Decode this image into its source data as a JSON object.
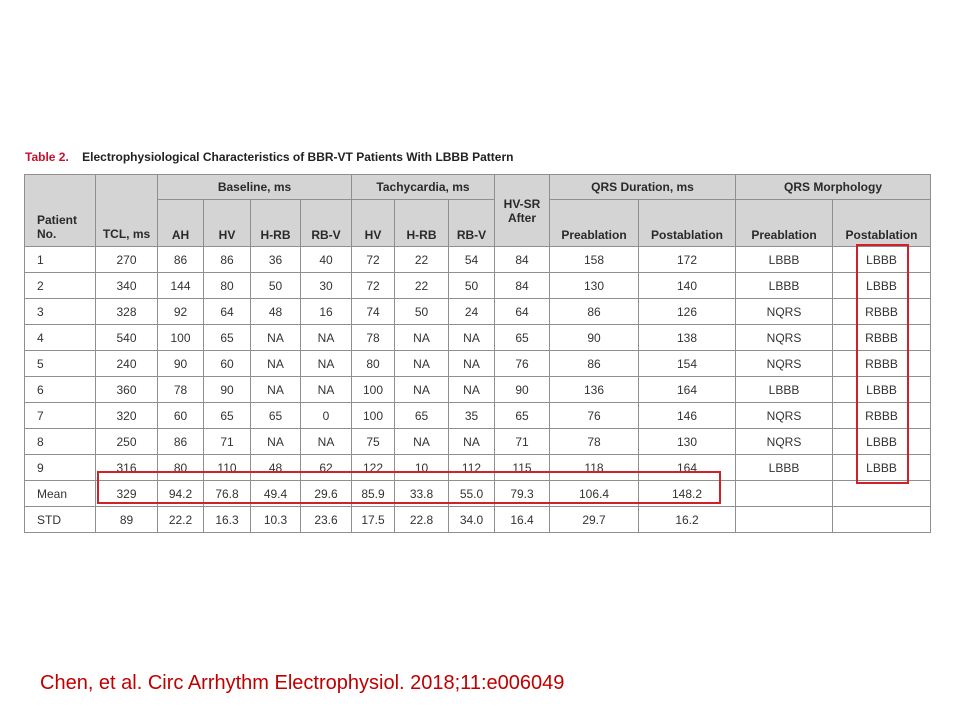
{
  "table": {
    "number": "Table 2.",
    "title": "Electrophysiological Characteristics of BBR-VT Patients With LBBB Pattern",
    "group_headers": {
      "patient": "Patient No.",
      "tcl": "TCL, ms",
      "baseline": "Baseline, ms",
      "tachycardia": "Tachycardia, ms",
      "hvsr": "HV-SR After",
      "qrs_duration": "QRS Duration, ms",
      "qrs_morphology": "QRS Morphology"
    },
    "sub_headers": {
      "b_ah": "AH",
      "b_hv": "HV",
      "b_hrb": "H-RB",
      "b_rbv": "RB-V",
      "t_hv": "HV",
      "t_hrb": "H-RB",
      "t_rbv": "RB-V",
      "qd_pre": "Preablation",
      "qd_post": "Postablation",
      "qm_pre": "Preablation",
      "qm_post": "Postablation"
    },
    "rows": [
      [
        "1",
        "270",
        "86",
        "86",
        "36",
        "40",
        "72",
        "22",
        "54",
        "84",
        "158",
        "172",
        "LBBB",
        "LBBB"
      ],
      [
        "2",
        "340",
        "144",
        "80",
        "50",
        "30",
        "72",
        "22",
        "50",
        "84",
        "130",
        "140",
        "LBBB",
        "LBBB"
      ],
      [
        "3",
        "328",
        "92",
        "64",
        "48",
        "16",
        "74",
        "50",
        "24",
        "64",
        "86",
        "126",
        "NQRS",
        "RBBB"
      ],
      [
        "4",
        "540",
        "100",
        "65",
        "NA",
        "NA",
        "78",
        "NA",
        "NA",
        "65",
        "90",
        "138",
        "NQRS",
        "RBBB"
      ],
      [
        "5",
        "240",
        "90",
        "60",
        "NA",
        "NA",
        "80",
        "NA",
        "NA",
        "76",
        "86",
        "154",
        "NQRS",
        "RBBB"
      ],
      [
        "6",
        "360",
        "78",
        "90",
        "NA",
        "NA",
        "100",
        "NA",
        "NA",
        "90",
        "136",
        "164",
        "LBBB",
        "LBBB"
      ],
      [
        "7",
        "320",
        "60",
        "65",
        "65",
        "0",
        "100",
        "65",
        "35",
        "65",
        "76",
        "146",
        "NQRS",
        "RBBB"
      ],
      [
        "8",
        "250",
        "86",
        "71",
        "NA",
        "NA",
        "75",
        "NA",
        "NA",
        "71",
        "78",
        "130",
        "NQRS",
        "LBBB"
      ],
      [
        "9",
        "316",
        "80",
        "110",
        "48",
        "62",
        "122",
        "10",
        "112",
        "115",
        "118",
        "164",
        "LBBB",
        "LBBB"
      ],
      [
        "Mean",
        "329",
        "94.2",
        "76.8",
        "49.4",
        "29.6",
        "85.9",
        "33.8",
        "55.0",
        "79.3",
        "106.4",
        "148.2",
        "",
        ""
      ],
      [
        "STD",
        "89",
        "22.2",
        "16.3",
        "10.3",
        "23.6",
        "17.5",
        "22.8",
        "34.0",
        "16.4",
        "29.7",
        "16.2",
        "",
        ""
      ]
    ]
  },
  "highlight_color": "#d0202a",
  "citation": "Chen, et al. Circ Arrhythm Electrophysiol. 2018;11:e006049"
}
